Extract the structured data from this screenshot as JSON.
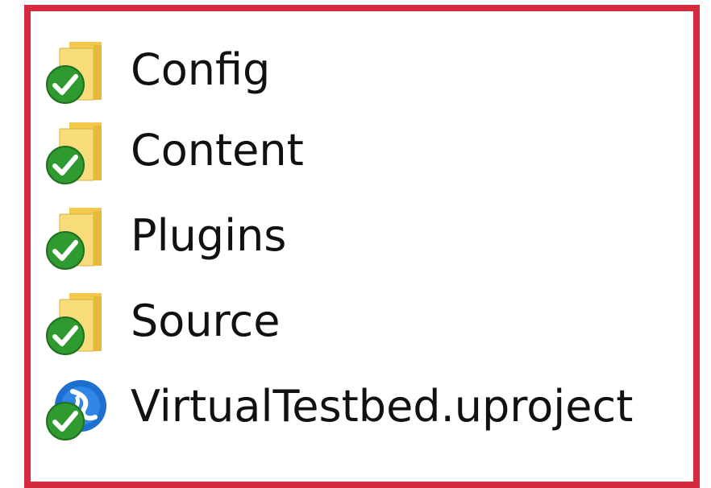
{
  "explorer": {
    "items": [
      {
        "label": "Config",
        "icon": "folder-icon",
        "overlay": "sync-ok-check-icon"
      },
      {
        "label": "Content",
        "icon": "folder-icon",
        "overlay": "sync-ok-check-icon"
      },
      {
        "label": "Plugins",
        "icon": "folder-icon",
        "overlay": "sync-ok-check-icon"
      },
      {
        "label": "Source",
        "icon": "folder-icon",
        "overlay": "sync-ok-check-icon"
      },
      {
        "label": "VirtualTestbed.uproject",
        "icon": "unreal-project-icon",
        "overlay": "sync-ok-check-icon"
      }
    ]
  },
  "colors": {
    "frame_border": "#d42a3d",
    "folder": "#f6d56e",
    "check_green": "#2f9a2f",
    "project_blue": "#1e6fd0"
  }
}
